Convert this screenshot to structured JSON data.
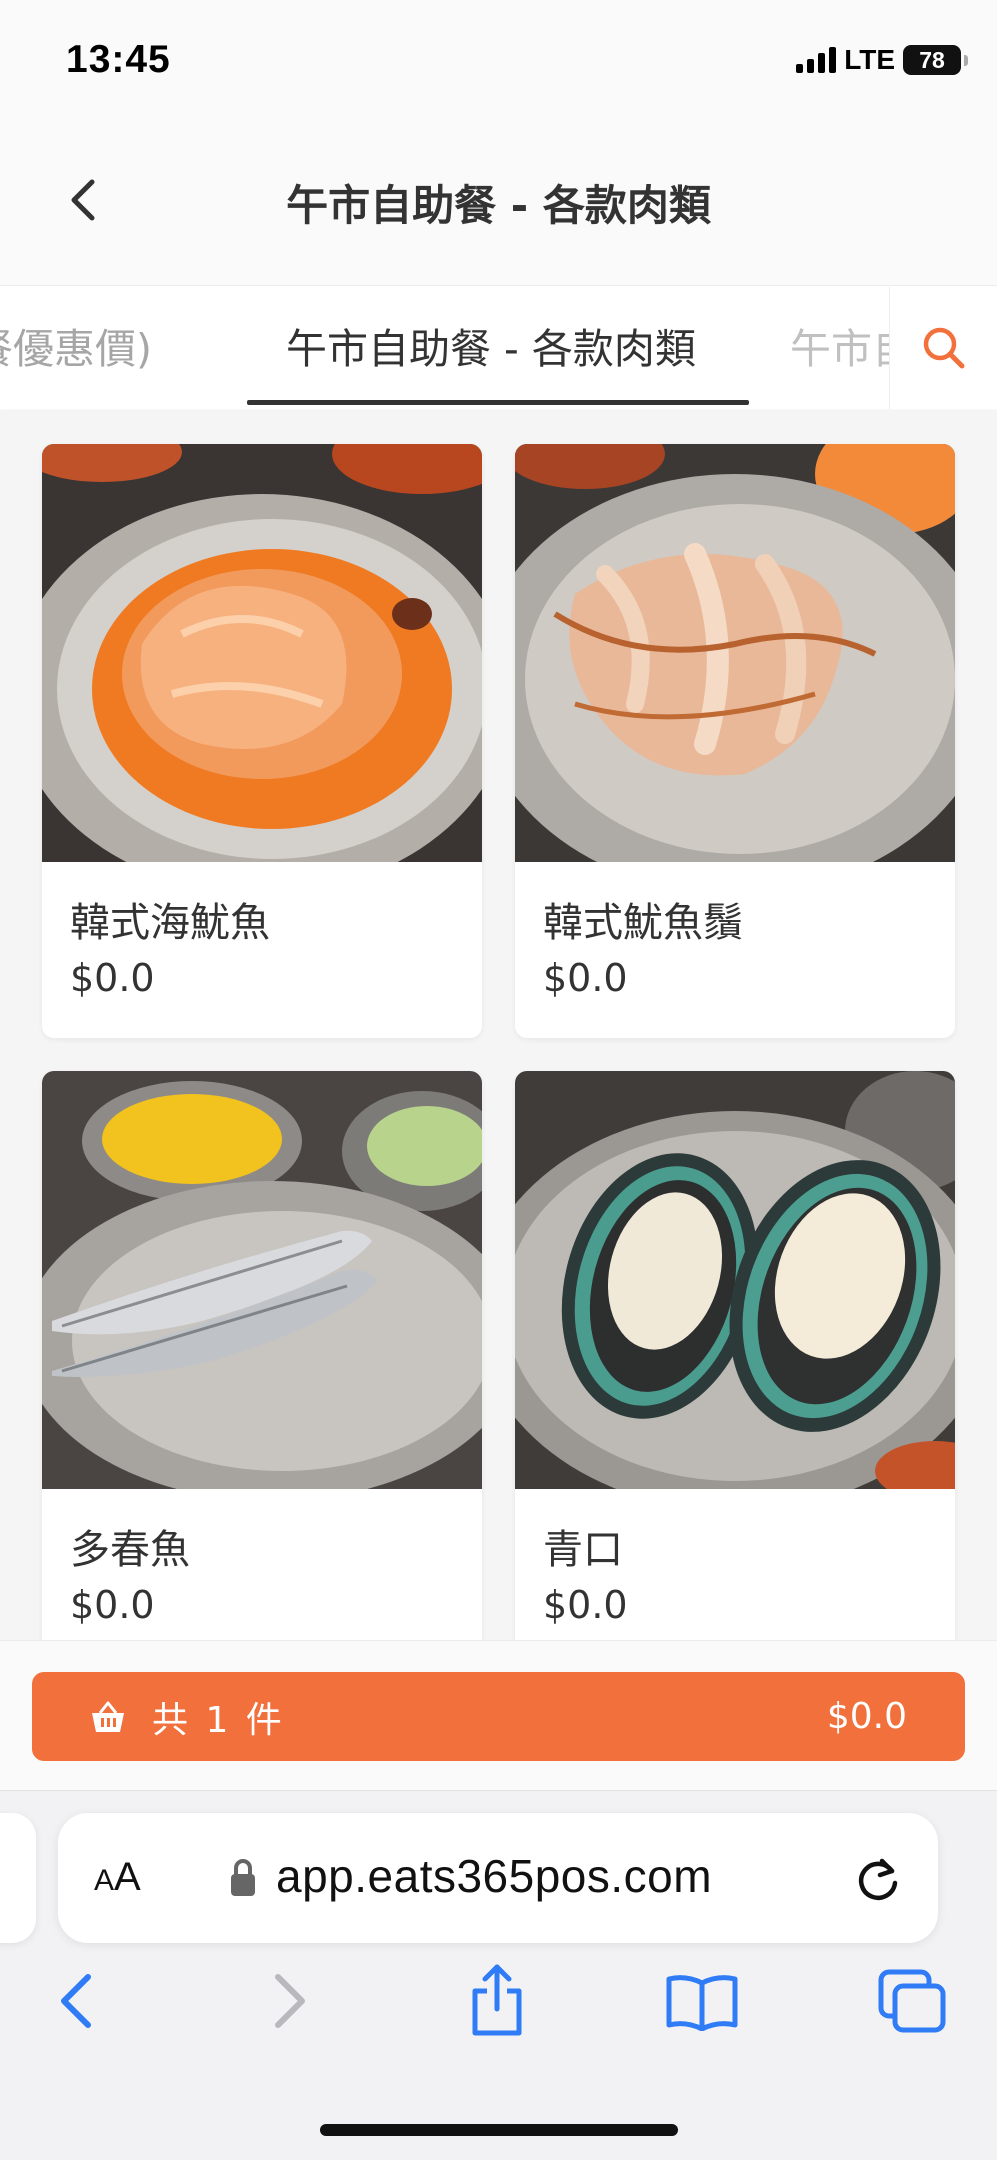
{
  "status_bar": {
    "time": "13:45",
    "network": "LTE",
    "battery": "78"
  },
  "header": {
    "title": "午市自助餐 - 各款肉類",
    "back_icon": "chevron-left-icon"
  },
  "tabs": {
    "previous": "餐優惠價)",
    "active": "午市自助餐 - 各款肉類",
    "next": "午市自",
    "search_icon": "search-icon",
    "accent_color": "#f2703b"
  },
  "items": [
    {
      "name": "韓式海魷魚",
      "price": "$0.0"
    },
    {
      "name": "韓式魷魚鬚",
      "price": "$0.0"
    },
    {
      "name": "多春魚",
      "price": "$0.0"
    },
    {
      "name": "青口",
      "price": "$0.0"
    }
  ],
  "cart": {
    "count_label": "共 1 件",
    "total": "$0.0",
    "icon": "basket-icon",
    "color": "#f2703b"
  },
  "browser": {
    "text_size_label": "AA",
    "url": "app.eats365pos.com",
    "icons": [
      "lock-icon",
      "reload-icon",
      "back-arrow-icon",
      "forward-arrow-icon",
      "share-icon",
      "bookmarks-icon",
      "tabs-icon"
    ],
    "tint_color": "#2f7cf6"
  }
}
